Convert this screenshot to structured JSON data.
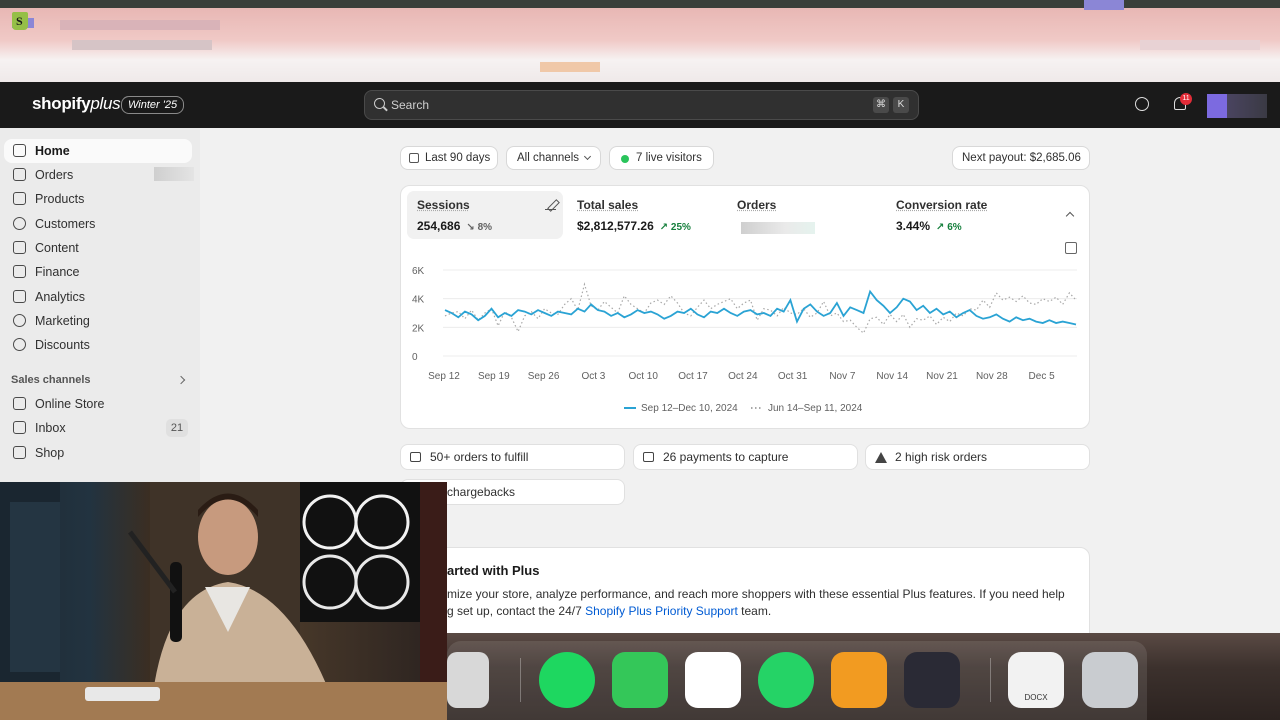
{
  "topbar": {
    "brand_main": "shopify",
    "brand_plus": "plus",
    "edition": "Winter '25",
    "search_placeholder": "Search",
    "shortcut_key1": "⌘",
    "shortcut_key2": "K",
    "notification_count": "11"
  },
  "sidebar": {
    "items": [
      {
        "label": "Home"
      },
      {
        "label": "Orders"
      },
      {
        "label": "Products"
      },
      {
        "label": "Customers"
      },
      {
        "label": "Content"
      },
      {
        "label": "Finance"
      },
      {
        "label": "Analytics"
      },
      {
        "label": "Marketing"
      },
      {
        "label": "Discounts"
      }
    ],
    "section_label": "Sales channels",
    "channels": [
      {
        "label": "Online Store"
      },
      {
        "label": "Inbox",
        "count": "21"
      },
      {
        "label": "Shop"
      }
    ]
  },
  "filters": {
    "date_range": "Last 90 days",
    "channels": "All channels",
    "live_visitors": "7 live visitors",
    "next_payout": "Next payout: $2,685.06"
  },
  "metrics": [
    {
      "title": "Sessions",
      "value": "254,686",
      "delta": "8%"
    },
    {
      "title": "Total sales",
      "value": "$2,812,577.26",
      "delta": "25%"
    },
    {
      "title": "Orders"
    },
    {
      "title": "Conversion rate",
      "value": "3.44%",
      "delta": "6%"
    }
  ],
  "chart_data": {
    "type": "line",
    "y_ticks": [
      "6K",
      "4K",
      "2K",
      "0"
    ],
    "ylim": [
      0,
      6000
    ],
    "x_tick_labels": [
      "Sep 12",
      "Sep 19",
      "Sep 26",
      "Oct 3",
      "Oct 10",
      "Oct 17",
      "Oct 24",
      "Oct 31",
      "Nov 7",
      "Nov 14",
      "Nov 21",
      "Nov 28",
      "Dec 5"
    ],
    "series": [
      {
        "name": "Sep 12–Dec 10, 2024",
        "style": "solid",
        "color": "#2aa3d4",
        "values": [
          3200,
          3000,
          2700,
          3100,
          2900,
          2500,
          2800,
          3300,
          2700,
          3000,
          2800,
          3200,
          3100,
          2900,
          3200,
          3000,
          2800,
          3100,
          3000,
          2900,
          3300,
          3100,
          3600,
          3200,
          3100,
          2800,
          3000,
          2700,
          2900,
          3200,
          3000,
          3100,
          2900,
          2600,
          2800,
          3100,
          3000,
          3300,
          2900,
          2700,
          3100,
          3000,
          3300,
          3000,
          2800,
          3100,
          3200,
          2900,
          3000,
          2800,
          3300,
          3100,
          3900,
          2400,
          3300,
          3600,
          3100,
          2800,
          3000,
          3700,
          2800,
          3400,
          3200,
          3000,
          4500,
          3900,
          3500,
          3000,
          3400,
          4000,
          3800,
          3200,
          3500,
          3000,
          3300,
          2900,
          3100,
          2700,
          3000,
          3200,
          2800,
          2600,
          2700,
          2900,
          2600,
          2400,
          2700,
          2500,
          2600,
          2400,
          2300,
          2500,
          2300,
          2400,
          2300,
          2200
        ]
      },
      {
        "name": "Jun 14–Sep 11, 2024",
        "style": "dotted",
        "color": "#a8a8a8",
        "values": [
          2800,
          3000,
          3100,
          2600,
          3200,
          2500,
          3000,
          3300,
          2100,
          3100,
          2700,
          1700,
          2800,
          3100,
          2600,
          3300,
          3000,
          2900,
          3600,
          4000,
          3200,
          5000,
          3500,
          3200,
          3800,
          3400,
          3000,
          4200,
          3600,
          3300,
          3000,
          3700,
          3900,
          3600,
          4200,
          3700,
          3000,
          2800,
          3400,
          3900,
          3300,
          3600,
          3800,
          4000,
          3300,
          3700,
          3900,
          2500,
          3300,
          3200,
          2800,
          3400,
          3000,
          2900,
          3300,
          2700,
          3000,
          3800,
          2800,
          3000,
          2400,
          2500,
          2000,
          1600,
          2600,
          2700,
          2200,
          2900,
          2400,
          2900,
          2000,
          2600,
          2500,
          2800,
          2200,
          2700,
          2400,
          3000,
          2800,
          3300,
          3200,
          3900,
          3400,
          4400,
          3900,
          4100,
          3800,
          4200,
          3700,
          3600,
          4000,
          3800,
          4100,
          3600,
          4400,
          3900
        ]
      }
    ]
  },
  "tasks": [
    {
      "label": "50+ orders to fulfill"
    },
    {
      "label": "26 payments to capture"
    },
    {
      "label": "2 high risk orders"
    },
    {
      "label": "chargebacks"
    }
  ],
  "setup": {
    "title": "arted with Plus",
    "text_1": "mize your store, analyze performance, and reach more shoppers with these essential Plus features. If you need help",
    "text_2": "g set up, contact the 24/7 ",
    "link": "Shopify Plus Priority Support",
    "text_3": " team."
  },
  "dock": {
    "apps": [
      {
        "name": "phone-mirroring-icon",
        "color": "#d8d8d8"
      },
      {
        "name": "spotify-icon",
        "color": "#1ed760"
      },
      {
        "name": "messages-icon",
        "color": "#34c759"
      },
      {
        "name": "slack-icon",
        "color": "#ffffff"
      },
      {
        "name": "whatsapp-icon",
        "color": "#25d366"
      },
      {
        "name": "pages-icon",
        "color": "#f29b21"
      },
      {
        "name": "obs-icon",
        "color": "#2a2a35"
      },
      {
        "name": "docx-file-icon",
        "color": "#f2f2f2"
      },
      {
        "name": "trash-icon",
        "color": "#c9ccd0"
      }
    ],
    "docx_label": "DOCX"
  },
  "colors": {
    "accent": "#005bd3",
    "success": "#157f3c",
    "chart_primary": "#2aa3d4"
  }
}
